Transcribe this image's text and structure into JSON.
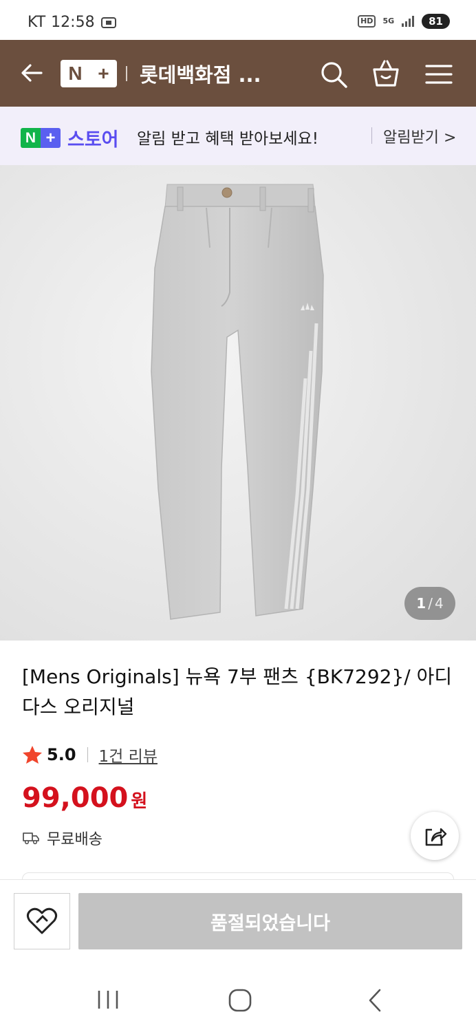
{
  "status_bar": {
    "carrier": "KT",
    "time": "12:58",
    "hd": "HD",
    "network": "5G",
    "battery": "81"
  },
  "header": {
    "logo_n": "N",
    "logo_plus": "+",
    "title": "롯데백화점 ..."
  },
  "banner": {
    "logo_n": "N",
    "logo_plus": "+",
    "store_label": "스토어",
    "message": "알림 받고 혜택 받아보세요!",
    "link_label": "알림받기 >"
  },
  "gallery": {
    "current": "1",
    "separator": "/",
    "total": "4"
  },
  "product": {
    "title": "[Mens Originals] 뉴욕 7부 팬츠 {BK7292}/ 아디다스 오리지널",
    "rating": "5.0",
    "review_link": "1건 리뷰",
    "price": "99,000",
    "price_unit": "원",
    "shipping": "무료배송"
  },
  "actions": {
    "soldout_label": "품절되었습니다"
  },
  "colors": {
    "header_bg": "#6b4f3e",
    "banner_bg": "#f2effa",
    "price": "#d4111d",
    "soldout_bg": "#c2c2c2",
    "naver_green": "#11b44a",
    "store_purple": "#5a4df0"
  }
}
